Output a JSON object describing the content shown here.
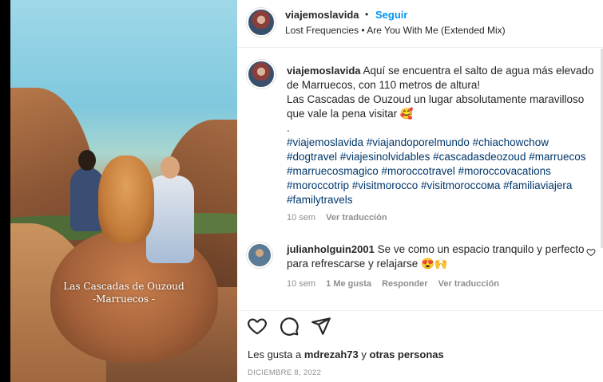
{
  "media": {
    "caption_line1": "Las Cascadas de Ouzoud",
    "caption_line2": "-Marruecos -"
  },
  "header": {
    "username": "viajemoslavida",
    "separator": "•",
    "follow_label": "Seguir",
    "music": "Lost Frequencies • Are You With Me (Extended Mix)"
  },
  "post": {
    "username": "viajemoslavida",
    "line1": "Aquí se encuentra el salto de agua más elevado",
    "line2": "de Marruecos, con 110 metros de altura!",
    "line3": "Las Cascadas de Ouzoud un lugar absolutamente maravilloso",
    "line4": "que vale la pena visitar 🥰",
    "line5": ".",
    "hashtags": [
      "#viajemoslavida #viajandoporelmundo #chiachowchow",
      "#dogtravel #viajesinolvidables #cascadasdeozoud #marruecos",
      "#marruecosmagico #moroccotravel #moroccovacations",
      "#moroccotrip #visitmorocco #visitmoroccoмa #familiaviajera",
      "#familytravels"
    ],
    "time": "10 sem",
    "translate": "Ver traducción"
  },
  "comment": {
    "username": "julianholguin2001",
    "line1": "Se ve como un espacio tranquilo y perfecto",
    "line2": "para refrescarse y relajarse 😍🙌",
    "time": "10 sem",
    "likes": "1 Me gusta",
    "reply": "Responder",
    "translate": "Ver traducción"
  },
  "footer": {
    "likes_prefix": "Les gusta a",
    "likes_user": "mdrezah73",
    "likes_joiner": "y",
    "likes_others": "otras personas",
    "date": "DICIEMBRE 8, 2022"
  },
  "colors": {
    "link": "#0095f6",
    "hashtag": "#00376b",
    "muted": "#8e8e8e",
    "text": "#262626"
  }
}
